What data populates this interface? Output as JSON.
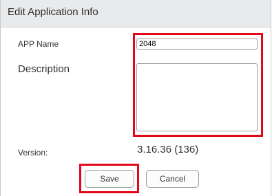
{
  "dialog": {
    "title": "Edit Application Info"
  },
  "form": {
    "app_name_label": "APP Name",
    "app_name_value": "2048",
    "description_label": "Description",
    "description_value": "",
    "version_label": "Version:",
    "version_value": "3.16.36 (136)"
  },
  "buttons": {
    "save_label": "Save",
    "cancel_label": "Cancel"
  },
  "colors": {
    "highlight": "#e4061b",
    "title_bar_bg": "#e9eaec"
  }
}
